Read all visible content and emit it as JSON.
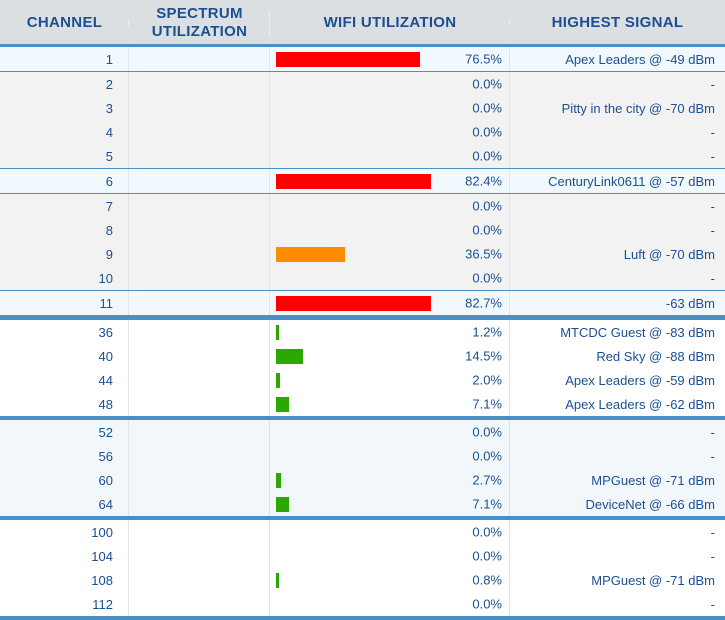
{
  "table": {
    "columns": [
      {
        "key": "channel",
        "label": "CHANNEL"
      },
      {
        "key": "spectrum",
        "label": "SPECTRUM UTILIZATION",
        "label_line1": "SPECTRUM",
        "label_line2": "UTILIZATION"
      },
      {
        "key": "wifi",
        "label": "WIFI UTILIZATION"
      },
      {
        "key": "signal",
        "label": "HIGHEST SIGNAL"
      }
    ],
    "colors": {
      "header_bg": "#dcdfe1",
      "header_text": "#1b4f91",
      "rule": "#4a90c4",
      "bar_high": "#ff0000",
      "bar_mid": "#ff8c00",
      "bar_low": "#2ca802",
      "row_highlight_bg": "#f1f8fe",
      "row_bg": "#f2f2f2",
      "row_bg_alt": "#ffffff",
      "text": "#1b4f91"
    },
    "bar_scale_max_percent": 100,
    "empty_value": "-",
    "groups": [
      {
        "name": "band-2_4ghz-group-1",
        "rows": [
          {
            "channel": "1",
            "wifi_percent": "76.5%",
            "wifi_value": 76.5,
            "severity": "high",
            "signal": "Apex Leaders @ -49 dBm",
            "highlight": true,
            "shade": "pale"
          }
        ]
      },
      {
        "name": "band-2_4ghz-group-2",
        "rows": [
          {
            "channel": "2",
            "wifi_percent": "0.0%",
            "wifi_value": 0,
            "severity": "none",
            "signal": "-",
            "highlight": false,
            "shade": "gray"
          },
          {
            "channel": "3",
            "wifi_percent": "0.0%",
            "wifi_value": 0,
            "severity": "none",
            "signal": "Pitty in the city @ -70 dBm",
            "highlight": false,
            "shade": "gray"
          },
          {
            "channel": "4",
            "wifi_percent": "0.0%",
            "wifi_value": 0,
            "severity": "none",
            "signal": "-",
            "highlight": false,
            "shade": "gray"
          },
          {
            "channel": "5",
            "wifi_percent": "0.0%",
            "wifi_value": 0,
            "severity": "none",
            "signal": "-",
            "highlight": false,
            "shade": "gray"
          }
        ]
      },
      {
        "name": "band-2_4ghz-group-3",
        "rows": [
          {
            "channel": "6",
            "wifi_percent": "82.4%",
            "wifi_value": 82.4,
            "severity": "high",
            "signal": "CenturyLink0611 @ -57 dBm",
            "highlight": true,
            "shade": "pale"
          }
        ]
      },
      {
        "name": "band-2_4ghz-group-4",
        "rows": [
          {
            "channel": "7",
            "wifi_percent": "0.0%",
            "wifi_value": 0,
            "severity": "none",
            "signal": "-",
            "highlight": false,
            "shade": "gray"
          },
          {
            "channel": "8",
            "wifi_percent": "0.0%",
            "wifi_value": 0,
            "severity": "none",
            "signal": "-",
            "highlight": false,
            "shade": "gray"
          },
          {
            "channel": "9",
            "wifi_percent": "36.5%",
            "wifi_value": 36.5,
            "severity": "mid",
            "signal": "Luft @ -70 dBm",
            "highlight": false,
            "shade": "gray"
          },
          {
            "channel": "10",
            "wifi_percent": "0.0%",
            "wifi_value": 0,
            "severity": "none",
            "signal": "-",
            "highlight": false,
            "shade": "gray"
          }
        ]
      },
      {
        "name": "band-2_4ghz-group-5",
        "rows": [
          {
            "channel": "11",
            "wifi_percent": "82.7%",
            "wifi_value": 82.7,
            "severity": "high",
            "signal": "-63 dBm",
            "highlight": true,
            "shade": "pale"
          }
        ]
      },
      {
        "name": "band-5ghz-unii1",
        "separator_above": true,
        "rows": [
          {
            "channel": "36",
            "wifi_percent": "1.2%",
            "wifi_value": 1.2,
            "severity": "low",
            "signal": "MTCDC Guest @ -83 dBm",
            "highlight": false,
            "shade": "white"
          },
          {
            "channel": "40",
            "wifi_percent": "14.5%",
            "wifi_value": 14.5,
            "severity": "low",
            "signal": "Red Sky @ -88 dBm",
            "highlight": false,
            "shade": "white"
          },
          {
            "channel": "44",
            "wifi_percent": "2.0%",
            "wifi_value": 2.0,
            "severity": "low",
            "signal": "Apex Leaders @ -59 dBm",
            "highlight": false,
            "shade": "white"
          },
          {
            "channel": "48",
            "wifi_percent": "7.1%",
            "wifi_value": 7.1,
            "severity": "low",
            "signal": "Apex Leaders @ -62 dBm",
            "highlight": false,
            "shade": "white"
          }
        ]
      },
      {
        "name": "band-5ghz-unii2a",
        "separator_above": true,
        "rows": [
          {
            "channel": "52",
            "wifi_percent": "0.0%",
            "wifi_value": 0,
            "severity": "none",
            "signal": "-",
            "highlight": false,
            "shade": "pale"
          },
          {
            "channel": "56",
            "wifi_percent": "0.0%",
            "wifi_value": 0,
            "severity": "none",
            "signal": "-",
            "highlight": false,
            "shade": "pale"
          },
          {
            "channel": "60",
            "wifi_percent": "2.7%",
            "wifi_value": 2.7,
            "severity": "low",
            "signal": "MPGuest @ -71 dBm",
            "highlight": false,
            "shade": "pale"
          },
          {
            "channel": "64",
            "wifi_percent": "7.1%",
            "wifi_value": 7.1,
            "severity": "low",
            "signal": "DeviceNet @ -66 dBm",
            "highlight": false,
            "shade": "pale"
          }
        ]
      },
      {
        "name": "band-5ghz-unii2c",
        "separator_above": true,
        "rows": [
          {
            "channel": "100",
            "wifi_percent": "0.0%",
            "wifi_value": 0,
            "severity": "none",
            "signal": "-",
            "highlight": false,
            "shade": "white"
          },
          {
            "channel": "104",
            "wifi_percent": "0.0%",
            "wifi_value": 0,
            "severity": "none",
            "signal": "-",
            "highlight": false,
            "shade": "white"
          },
          {
            "channel": "108",
            "wifi_percent": "0.8%",
            "wifi_value": 0.8,
            "severity": "low",
            "signal": "MPGuest @ -71 dBm",
            "highlight": false,
            "shade": "white"
          },
          {
            "channel": "112",
            "wifi_percent": "0.0%",
            "wifi_value": 0,
            "severity": "none",
            "signal": "-",
            "highlight": false,
            "shade": "white"
          }
        ]
      }
    ]
  }
}
